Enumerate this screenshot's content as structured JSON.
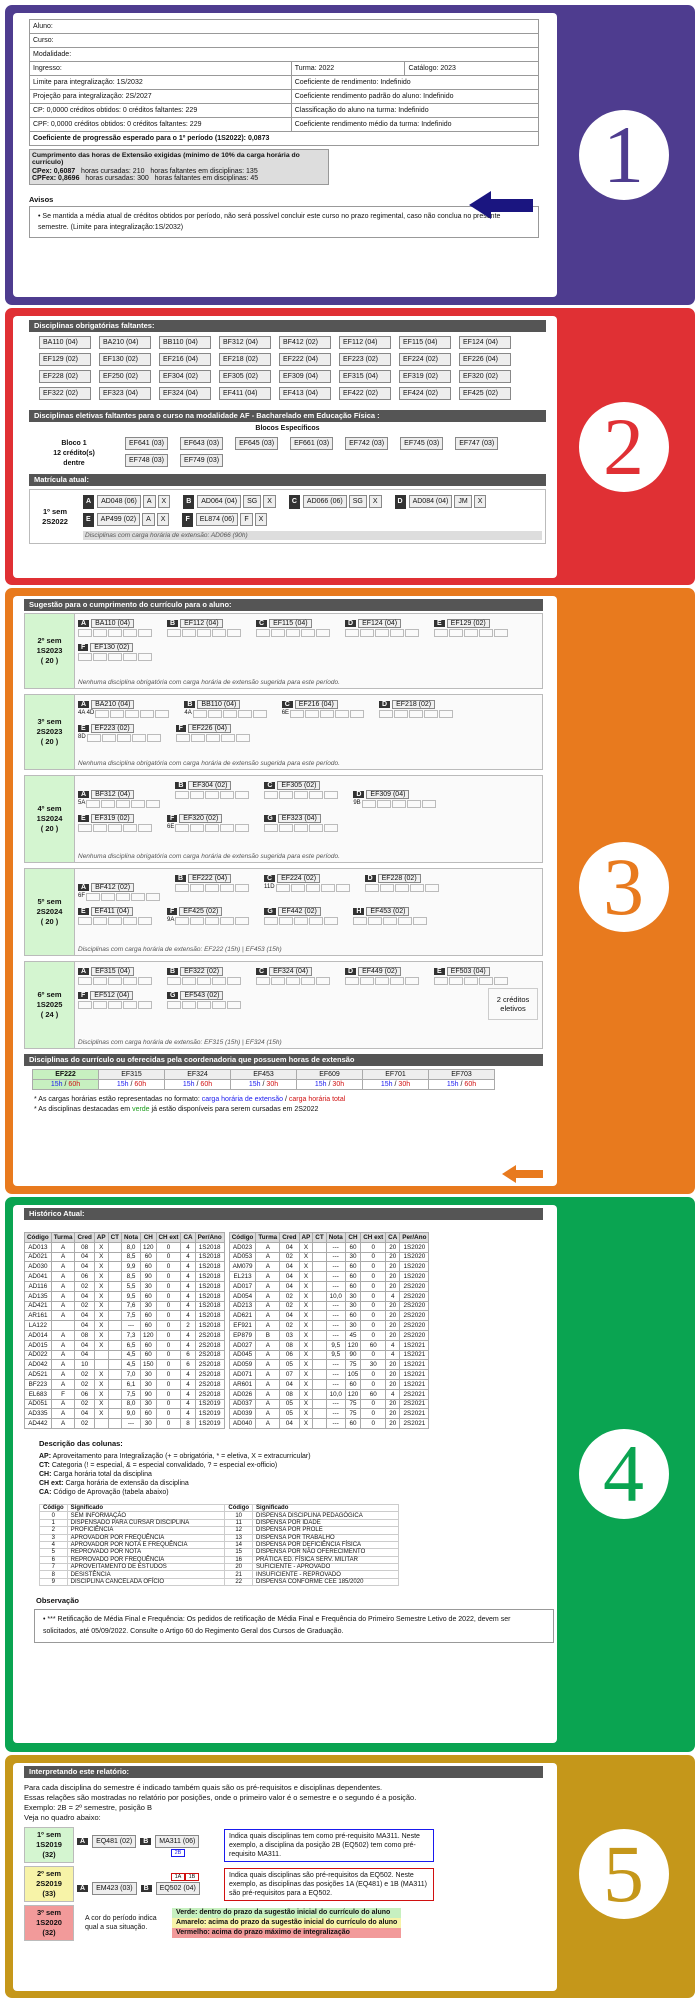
{
  "s1": {
    "num": "1",
    "rows": [
      [
        "Aluno:",
        ""
      ],
      [
        "Curso:",
        ""
      ],
      [
        "Modalidade:",
        ""
      ],
      [
        "Ingresso:",
        "Turma: 2022",
        "Catálogo: 2023"
      ],
      [
        "Limite para integralização: 1S/2032",
        "Coeficiente de rendimento: Indefinido"
      ],
      [
        "Projeção para integralização: 2S/2027",
        "Coeficiente rendimento padrão do aluno: Indefinido"
      ],
      [
        "CP: 0,0000   créditos obtidos: 0     créditos faltantes: 229",
        "Classificação do aluno na turma: Indefinido"
      ],
      [
        "CPF: 0,0000  créditos obtidos: 0     créditos faltantes: 229",
        "Coeficiente rendimento médio da turma: Indefinido"
      ],
      [
        "Coeficiente de progressão esperado para o 1º período (1S2022): 0,0873",
        ""
      ]
    ],
    "ext_title": "Cumprimento das horas de Extensão exigidas (mínimo de 10% da carga horária do currículo)",
    "ext1": [
      "CPex: 0,6087",
      "horas cursadas: 210",
      "horas faltantes em disciplinas: 135"
    ],
    "ext2": [
      "CPFex: 0,8696",
      "horas cursadas: 300",
      "horas faltantes em disciplinas: 45"
    ],
    "avisos_title": "Avisos",
    "aviso": "Se mantida a média atual de créditos obtidos por período, não será possível concluir este curso no prazo regimental, caso não conclua no presente semestre. (Limite para integralização:1S/2032)"
  },
  "s2": {
    "num": "2",
    "h1": "Disciplinas obrigatórias faltantes:",
    "obr": [
      "BA110 (04)",
      "BA210 (04)",
      "BB110 (04)",
      "BF312 (04)",
      "BF412 (02)",
      "EF112 (04)",
      "EF115 (04)",
      "EF124 (04)",
      "EF129 (02)",
      "EF130 (02)",
      "EF216 (04)",
      "EF218 (02)",
      "EF222 (04)",
      "EF223 (02)",
      "EF224 (02)",
      "EF226 (04)",
      "EF228 (02)",
      "EF250 (02)",
      "EF304 (02)",
      "EF305 (02)",
      "EF309 (04)",
      "EF315 (04)",
      "EF319 (02)",
      "EF320 (02)",
      "EF322 (02)",
      "EF323 (04)",
      "EF324 (04)",
      "EF411 (04)",
      "EF413 (04)",
      "EF422 (02)",
      "EF424 (02)",
      "EF425 (02)"
    ],
    "h2": "Disciplinas eletivas faltantes para o curso na modalidade AF - Bacharelado em Educação Física :",
    "blocos": "Blocos Específicos",
    "bloco_lbl": [
      "Bloco 1",
      "12 crédito(s)",
      "dentre"
    ],
    "elet": [
      "EF641 (03)",
      "EF643 (03)",
      "EF645 (03)",
      "EF661 (03)",
      "EF742 (03)",
      "EF745 (03)",
      "EF747 (03)",
      "EF748 (03)",
      "EF749 (03)"
    ],
    "h3": "Matrícula atual:",
    "sem": [
      "1º sem",
      "2S2022"
    ],
    "mat": [
      [
        "A",
        "AD048 (06)",
        "A",
        "X"
      ],
      [
        "B",
        "AD064 (04)",
        "SG",
        "X"
      ],
      [
        "C",
        "AD066 (06)",
        "SG",
        "X"
      ],
      [
        "D",
        "AD084 (04)",
        "JM",
        "X"
      ],
      [
        "E",
        "AP499 (02)",
        "A",
        "X"
      ],
      [
        "F",
        "EL874 (06)",
        "F",
        "X"
      ]
    ],
    "mat_note": "Disciplinas com carga horária de extensão: AD066 (90h)"
  },
  "s3": {
    "num": "3",
    "h": "Sugestão para o cumprimento do currículo para o aluno:",
    "sems": [
      {
        "l": [
          "2º sem",
          "1S2023",
          "( 20 )"
        ],
        "c": [
          [
            "A",
            "BA110 (04)",
            ""
          ],
          [
            "B",
            "EF112 (04)",
            ""
          ],
          [
            "C",
            "EF115 (04)",
            ""
          ],
          [
            "D",
            "EF124 (04)",
            ""
          ],
          [
            "E",
            "EF129 (02)",
            ""
          ],
          [
            "F",
            "EF130 (02)",
            ""
          ]
        ],
        "note": "Nenhuma disciplina obrigatória com carga horária de extensão sugerida para este período."
      },
      {
        "l": [
          "3º sem",
          "2S2023",
          "( 20 )"
        ],
        "c": [
          [
            "A",
            "BA210 (04)",
            "4A 4D"
          ],
          [
            "B",
            "BB110 (04)",
            "4A"
          ],
          [
            "C",
            "EF216 (04)",
            "6E"
          ],
          [
            "D",
            "EF218 (02)",
            ""
          ],
          [
            "E",
            "EF223 (02)",
            "8D"
          ],
          [
            "F",
            "EF226 (04)",
            ""
          ]
        ],
        "note": "Nenhuma disciplina obrigatória com carga horária de extensão sugerida para este período."
      },
      {
        "l": [
          "4º sem",
          "1S2024",
          "( 20 )"
        ],
        "c": [
          [
            "A",
            "BF312 (04)",
            "5A"
          ],
          [
            "B",
            "EF304 (02)",
            ""
          ],
          [
            "C",
            "EF305 (02)",
            ""
          ],
          [
            "D",
            "EF309 (04)",
            "9B"
          ],
          [
            "E",
            "EF319 (02)",
            ""
          ],
          [
            "F",
            "EF320 (02)",
            "6E"
          ],
          [
            "G",
            "EF323 (04)",
            ""
          ]
        ],
        "note": "Nenhuma disciplina obrigatória com carga horária de extensão sugerida para este período."
      },
      {
        "l": [
          "5º sem",
          "2S2024",
          "( 20 )"
        ],
        "c": [
          [
            "A",
            "BF412 (02)",
            "6F"
          ],
          [
            "B",
            "EF222 (04)",
            ""
          ],
          [
            "C",
            "EF224 (02)",
            "11D"
          ],
          [
            "D",
            "EF228 (02)",
            ""
          ],
          [
            "E",
            "EF411 (04)",
            ""
          ],
          [
            "F",
            "EF425 (02)",
            "9A"
          ],
          [
            "G",
            "EF442 (02)",
            ""
          ],
          [
            "H",
            "EF453 (02)",
            ""
          ]
        ],
        "note": "Disciplinas com carga horária de extensão: EF222 (15h) | EF453 (15h)"
      },
      {
        "l": [
          "6º sem",
          "1S2025",
          "( 24 )"
        ],
        "c": [
          [
            "A",
            "EF315 (04)",
            ""
          ],
          [
            "B",
            "EF322 (02)",
            ""
          ],
          [
            "C",
            "EF324 (04)",
            ""
          ],
          [
            "D",
            "EF449 (02)",
            ""
          ],
          [
            "E",
            "EF503 (04)",
            ""
          ],
          [
            "F",
            "EF512 (04)",
            ""
          ],
          [
            "G",
            "EF543 (02)",
            ""
          ]
        ],
        "extra": "2 créditos eletivos",
        "note": "Disciplinas com carga horária de extensão: EF315 (15h) | EF324 (15h)"
      }
    ],
    "h2": "Disciplinas do currículo ou oferecidas pela coordenadoria que possuem horas de extensão",
    "ext": [
      [
        "EF222",
        "15h",
        "60h"
      ],
      [
        "EF315",
        "15h",
        "60h"
      ],
      [
        "EF324",
        "15h",
        "60h"
      ],
      [
        "EF453",
        "15h",
        "30h"
      ],
      [
        "EF609",
        "15h",
        "30h"
      ],
      [
        "EF701",
        "15h",
        "30h"
      ],
      [
        "EF703",
        "15h",
        "60h"
      ]
    ],
    "n1a": "* As cargas horárias estão representadas no formato: ",
    "n1b": "carga horária de extensão",
    "n1c": " / ",
    "n1d": "carga horária total",
    "n2a": "* As disciplinas destacadas em ",
    "n2b": "verde",
    "n2c": " já estão disponíveis para serem cursadas em 2S2022"
  },
  "s4": {
    "num": "4",
    "h": "Histórico Atual:",
    "cols": [
      "Código",
      "Turma",
      "Cred",
      "AP",
      "CT",
      "Nota",
      "CH",
      "CH ext",
      "CA",
      "Per/Ano"
    ],
    "left": [
      [
        "AD013",
        "A",
        "08",
        "X",
        "",
        "8,0",
        "120",
        "0",
        "4",
        "1S2018"
      ],
      [
        "AD021",
        "A",
        "04",
        "X",
        "",
        "8,5",
        "60",
        "0",
        "4",
        "1S2018"
      ],
      [
        "AD030",
        "A",
        "04",
        "X",
        "",
        "9,9",
        "60",
        "0",
        "4",
        "1S2018"
      ],
      [
        "AD041",
        "A",
        "06",
        "X",
        "",
        "8,5",
        "90",
        "0",
        "4",
        "1S2018"
      ],
      [
        "AD116",
        "A",
        "02",
        "X",
        "",
        "5,5",
        "30",
        "0",
        "4",
        "1S2018"
      ],
      [
        "AD135",
        "A",
        "04",
        "X",
        "",
        "9,5",
        "60",
        "0",
        "4",
        "1S2018"
      ],
      [
        "AD421",
        "A",
        "02",
        "X",
        "",
        "7,6",
        "30",
        "0",
        "4",
        "1S2018"
      ],
      [
        "AR161",
        "A",
        "04",
        "X",
        "",
        "7,5",
        "60",
        "0",
        "4",
        "1S2018"
      ],
      [
        "LA122",
        "",
        "04",
        "X",
        "",
        "---",
        "60",
        "0",
        "2",
        "1S2018"
      ],
      [
        "AD014",
        "A",
        "08",
        "X",
        "",
        "7,3",
        "120",
        "0",
        "4",
        "2S2018"
      ],
      [
        "AD015",
        "A",
        "04",
        "X",
        "",
        "6,5",
        "60",
        "0",
        "4",
        "2S2018"
      ],
      [
        "AD022",
        "A",
        "04",
        "",
        "",
        "4,5",
        "60",
        "0",
        "6",
        "2S2018"
      ],
      [
        "AD042",
        "A",
        "10",
        "",
        "",
        "4,5",
        "150",
        "0",
        "6",
        "2S2018"
      ],
      [
        "AD521",
        "A",
        "02",
        "X",
        "",
        "7,0",
        "30",
        "0",
        "4",
        "2S2018"
      ],
      [
        "BF223",
        "A",
        "02",
        "X",
        "",
        "6,1",
        "30",
        "0",
        "4",
        "2S2018"
      ],
      [
        "EL683",
        "F",
        "06",
        "X",
        "",
        "7,5",
        "90",
        "0",
        "4",
        "2S2018"
      ],
      [
        "AD051",
        "A",
        "02",
        "X",
        "",
        "8,0",
        "30",
        "0",
        "4",
        "1S2019"
      ],
      [
        "AD335",
        "A",
        "04",
        "X",
        "",
        "9,0",
        "60",
        "0",
        "4",
        "1S2019"
      ],
      [
        "AD442",
        "A",
        "02",
        "",
        "",
        "---",
        "30",
        "0",
        "8",
        "1S2019"
      ]
    ],
    "right": [
      [
        "AD023",
        "A",
        "04",
        "X",
        "",
        "---",
        "60",
        "0",
        "20",
        "1S2020"
      ],
      [
        "AD053",
        "A",
        "02",
        "X",
        "",
        "---",
        "30",
        "0",
        "20",
        "1S2020"
      ],
      [
        "AM079",
        "A",
        "04",
        "X",
        "",
        "---",
        "60",
        "0",
        "20",
        "1S2020"
      ],
      [
        "EL213",
        "A",
        "04",
        "X",
        "",
        "---",
        "60",
        "0",
        "20",
        "1S2020"
      ],
      [
        "AD017",
        "A",
        "04",
        "X",
        "",
        "---",
        "60",
        "0",
        "20",
        "2S2020"
      ],
      [
        "AD054",
        "A",
        "02",
        "X",
        "",
        "10,0",
        "30",
        "0",
        "4",
        "2S2020"
      ],
      [
        "AD213",
        "A",
        "02",
        "X",
        "",
        "---",
        "30",
        "0",
        "20",
        "2S2020"
      ],
      [
        "AD621",
        "A",
        "04",
        "X",
        "",
        "---",
        "60",
        "0",
        "20",
        "2S2020"
      ],
      [
        "EF921",
        "A",
        "02",
        "X",
        "",
        "---",
        "30",
        "0",
        "20",
        "2S2020"
      ],
      [
        "EP879",
        "B",
        "03",
        "X",
        "",
        "---",
        "45",
        "0",
        "20",
        "2S2020"
      ],
      [
        "AD027",
        "A",
        "08",
        "X",
        "",
        "9,5",
        "120",
        "60",
        "4",
        "1S2021"
      ],
      [
        "AD045",
        "A",
        "06",
        "X",
        "",
        "9,5",
        "90",
        "0",
        "4",
        "1S2021"
      ],
      [
        "AD059",
        "A",
        "05",
        "X",
        "",
        "---",
        "75",
        "30",
        "20",
        "1S2021"
      ],
      [
        "AD071",
        "A",
        "07",
        "X",
        "",
        "---",
        "105",
        "0",
        "20",
        "1S2021"
      ],
      [
        "AR601",
        "A",
        "04",
        "X",
        "",
        "---",
        "60",
        "0",
        "20",
        "1S2021"
      ],
      [
        "AD026",
        "A",
        "08",
        "X",
        "",
        "10,0",
        "120",
        "60",
        "4",
        "2S2021"
      ],
      [
        "AD037",
        "A",
        "05",
        "X",
        "",
        "---",
        "75",
        "0",
        "20",
        "2S2021"
      ],
      [
        "AD039",
        "A",
        "05",
        "X",
        "",
        "---",
        "75",
        "0",
        "20",
        "2S2021"
      ],
      [
        "AD040",
        "A",
        "04",
        "X",
        "",
        "---",
        "60",
        "0",
        "20",
        "2S2021"
      ]
    ],
    "desc_h": "Descrição das colunas:",
    "desc": [
      [
        "AP:",
        "Aproveitamento para Integralização (+ = obrigatória, * = eletiva, X = extracurricular)"
      ],
      [
        "CT:",
        "Categoria (! = especial, & = especial convalidado, ? = especial ex-officio)"
      ],
      [
        "CH:",
        "Carga horária total da disciplina"
      ],
      [
        "CH ext:",
        "Carga horária de extensão da disciplina"
      ],
      [
        "CA:",
        "Código de Aprovação (tabela abaixo)"
      ]
    ],
    "leg_h": [
      "Código",
      "Significado",
      "Código",
      "Significado"
    ],
    "leg": [
      [
        "0",
        "SEM INFORMAÇÃO",
        "10",
        "DISPENSA DISCIPLINA PEDAGÓGICA"
      ],
      [
        "1",
        "DISPENSADO PARA CURSAR DISCIPLINA",
        "11",
        "DISPENSA POR IDADE"
      ],
      [
        "2",
        "PROFICIÊNCIA",
        "12",
        "DISPENSA POR PROLE"
      ],
      [
        "3",
        "APROVADOR POR FREQUÊNCIA",
        "13",
        "DISPENSA POR TRABALHO"
      ],
      [
        "4",
        "APROVADOR POR NOTA E FREQUÊNCIA",
        "14",
        "DISPENSA POR DEFICIÊNCIA FÍSICA"
      ],
      [
        "5",
        "REPROVADO POR NOTA",
        "15",
        "DISPENSA POR NÃO OFERECIMENTO"
      ],
      [
        "6",
        "REPROVADO POR FREQUÊNCIA",
        "16",
        "PRÁTICA ED. FÍSICA SERV. MILITAR"
      ],
      [
        "7",
        "APROVEITAMENTO DE ESTUDOS",
        "20",
        "SUFICIENTE - APROVADO"
      ],
      [
        "8",
        "DESISTÊNCIA",
        "21",
        "INSUFICIENTE - REPROVADO"
      ],
      [
        "9",
        "DISCIPLINA CANCELADA OFÍCIO",
        "22",
        "DISPENSA CONFORME CEE 185/2020"
      ]
    ],
    "obs_h": "Observação",
    "obs": "*** Retificação de Média Final e Frequência: Os pedidos de retificação de Média Final e Frequência do Primeiro Semestre Letivo de 2022, devem ser solicitados, até 05/09/2022. Consulte o Artigo 60 do Regimento Geral dos Cursos de Graduação."
  },
  "s5": {
    "num": "5",
    "h": "Interpretando este relatório:",
    "p": [
      "Para cada disciplina do semestre é indicado também quais são os pré-requisitos e disciplinas dependentes.",
      "Essas relações são mostradas no relatório por posições, onde o primeiro valor é o semestre e o segundo é a posição.",
      "Exemplo: 2B = 2º semestre, posição B",
      "Veja no quadro abaixo:"
    ],
    "r1": {
      "l": [
        "1º sem",
        "1S2019",
        "(32)"
      ],
      "c1": "EQ481 (02)",
      "c2": "MA311 (06)",
      "sub": "2B",
      "txt": "Indica quais disciplinas tem como pré-requisito MA311. Neste exemplo, a disciplina da posição 2B (EQ502) tem como pré-requisito MA311."
    },
    "r2": {
      "l": [
        "2º sem",
        "2S2019",
        "(33)"
      ],
      "c1": "EM423 (03)",
      "c2": "EQ502 (04)",
      "pre": [
        "1A",
        "1B"
      ],
      "txt": "Indica quais disciplinas são pré-requisitos da EQ502. Neste exemplo, as disciplinas das posições 1A (EQ481) e 1B (MA311) são pré-requisitos para a EQ502."
    },
    "r3": {
      "l": [
        "3º sem",
        "1S2020",
        "(32)"
      ],
      "txt": "A cor do período indica qual a sua situação.",
      "leg": [
        "Verde: dentro do prazo da sugestão inicial do currículo do aluno",
        "Amarelo: acima do prazo da sugestão inicial do currículo do aluno",
        "Vermelho: acima do prazo máximo de integralização"
      ]
    }
  },
  "colors": {
    "s1": "#4e3c8f",
    "s2": "#e03034",
    "s3": "#e87a1e",
    "s4": "#0aa451",
    "s5": "#c5971a",
    "green": "#1a9a1a",
    "blue": "#1a1aee",
    "red": "#d01010"
  }
}
